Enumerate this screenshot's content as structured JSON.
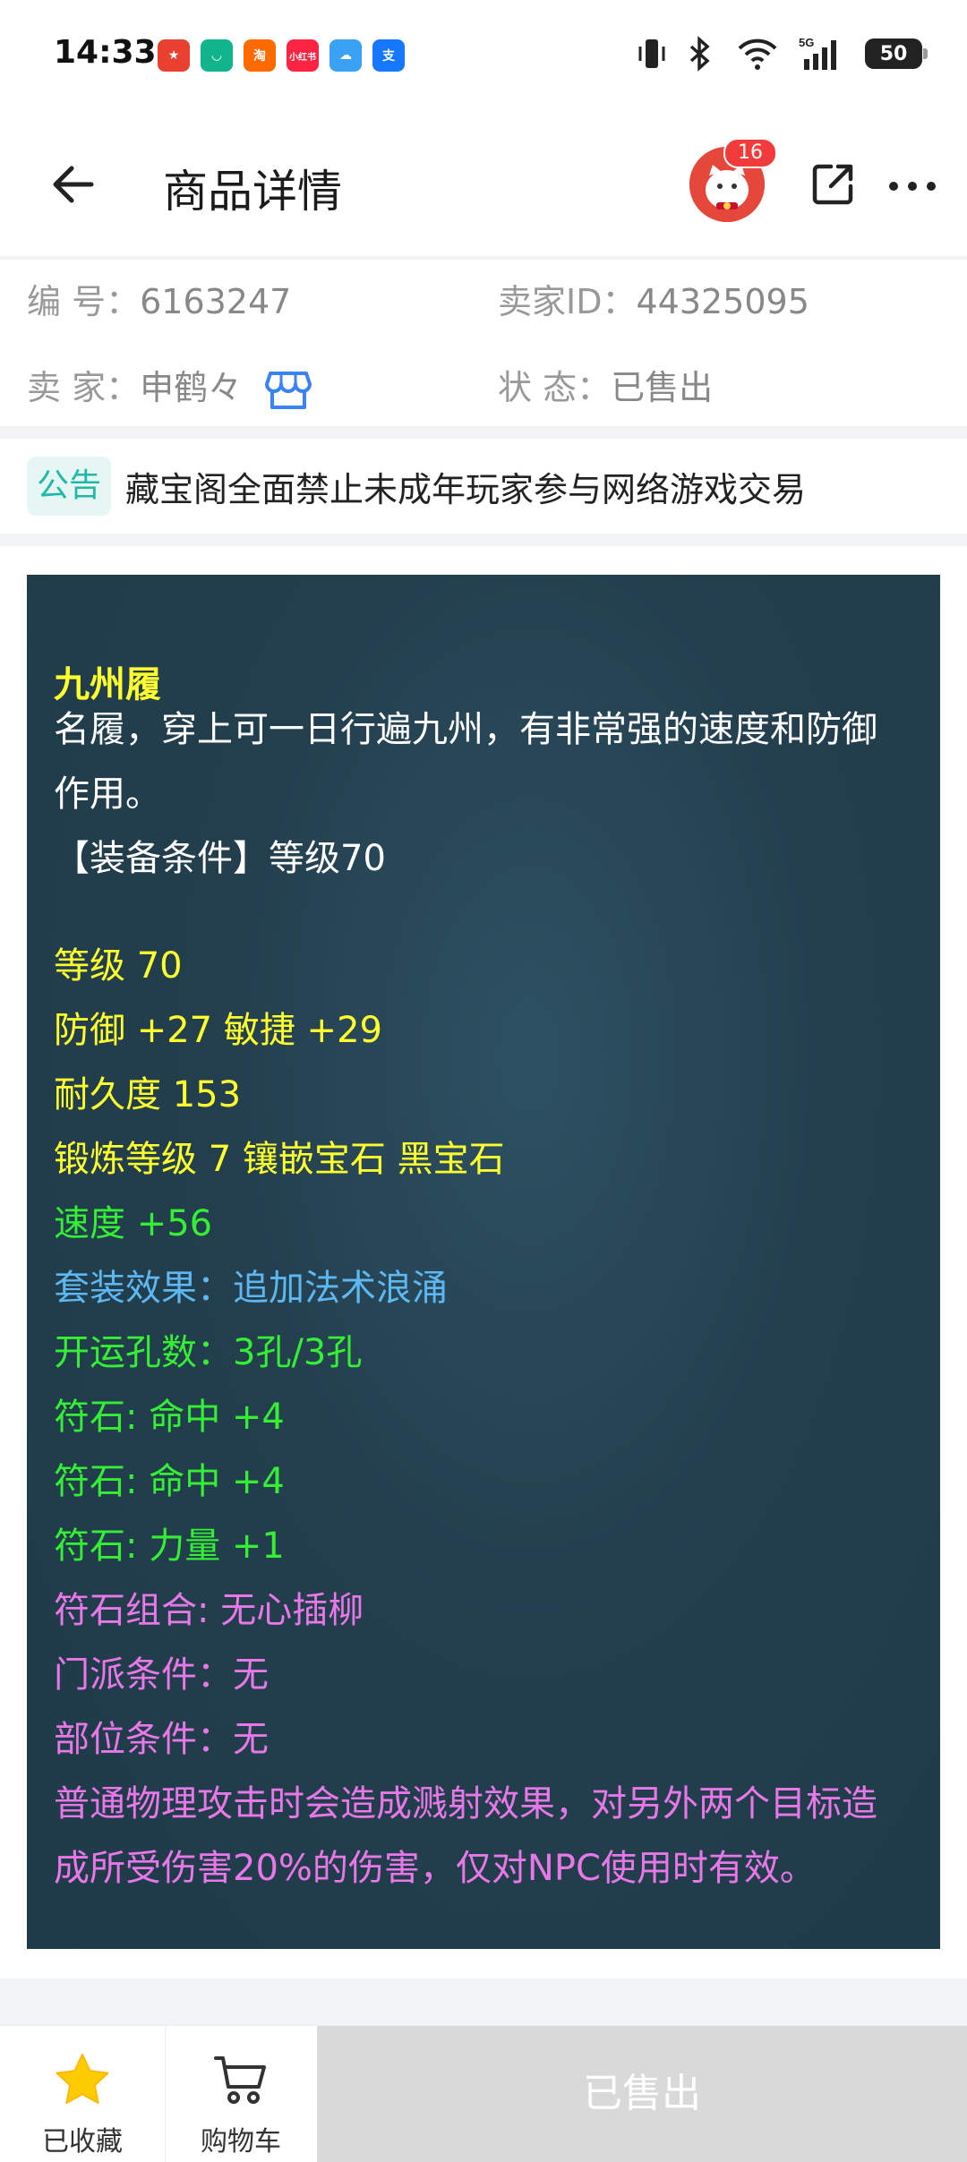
{
  "status_bar": {
    "time": "14:33",
    "apps": [
      {
        "icon": "app-icon-1",
        "text": "",
        "color": "#e8412f"
      },
      {
        "icon": "mi-icon",
        "text": "",
        "color": "#12b48c"
      },
      {
        "icon": "taobao-icon",
        "text": "淘",
        "color": "#ff6a00"
      },
      {
        "icon": "xiaohongshu-icon",
        "text": "小红书",
        "color": "#ff2442"
      },
      {
        "icon": "weather-icon",
        "text": "",
        "color": "#3aa1f5"
      },
      {
        "icon": "alipay-icon",
        "text": "支",
        "color": "#1677ff"
      }
    ],
    "battery": "50"
  },
  "header": {
    "title": "商品详情",
    "notification_count": "16"
  },
  "info": {
    "id_label": "编  号：",
    "id_value": "6163247",
    "seller_id_label": "卖家ID：",
    "seller_id_value": "44325095",
    "seller_label": "卖  家：",
    "seller_value": "申鹤々",
    "status_label": "状  态：",
    "status_value": "已售出"
  },
  "notice": {
    "tag": "公告",
    "text": "藏宝阁全面禁止未成年玩家参与网络游戏交易"
  },
  "item": {
    "name": "九州履",
    "desc_line1": "名履，穿上可一日行遍九州，有非常强的速度和防御",
    "desc_line2": "作用。",
    "requirement": "【装备条件】等级70",
    "level": "等级 70",
    "stats": "防御 +27 敏捷 +29",
    "durability": "耐久度 153",
    "forge": "锻炼等级 7 镶嵌宝石 黑宝石",
    "speed": "速度 +56",
    "set_effect": "套装效果：追加法术浪涌",
    "holes": "开运孔数：3孔/3孔",
    "rune1": "符石: 命中 +4",
    "rune2": "符石: 命中 +4",
    "rune3": "符石: 力量 +1",
    "rune_combo": "符石组合: 无心插柳",
    "school_req": "门派条件：无",
    "slot_req": "部位条件：无",
    "special_line1": "普通物理攻击时会造成溅射效果，对另外两个目标造",
    "special_line2": "成所受伤害20%的伤害，仅对NPC使用时有效。"
  },
  "bottom": {
    "favorite_label": "已收藏",
    "cart_label": "购物车",
    "sold_label": "已售出"
  }
}
